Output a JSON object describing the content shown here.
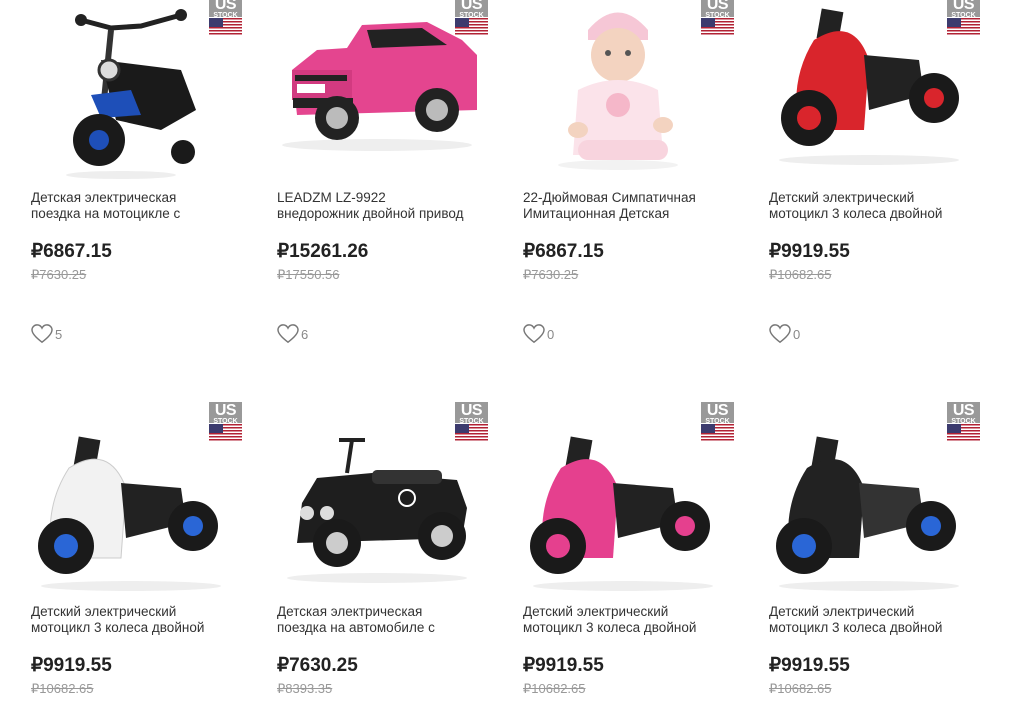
{
  "badge": {
    "us": "US",
    "stock": "STOCK"
  },
  "products": [
    {
      "title_l1": "Детская электрическая",
      "title_l2": "поездка на мотоцикле с",
      "price": "₽6867.15",
      "old_price": "₽7630.25",
      "likes": "5",
      "image": "kids-motorcycle-black-blue"
    },
    {
      "title_l1": "LEADZM LZ-9922",
      "title_l2": "внедорожник двойной привод",
      "price": "₽15261.26",
      "old_price": "₽17550.56",
      "likes": "6",
      "image": "pink-jeep"
    },
    {
      "title_l1": "22-Дюймовая Симпатичная",
      "title_l2": "Имитационная Детская",
      "price": "₽6867.15",
      "old_price": "₽7630.25",
      "likes": "0",
      "image": "reborn-doll"
    },
    {
      "title_l1": "Детский электрический",
      "title_l2": "мотоцикл 3 колеса двойной",
      "price": "₽9919.55",
      "old_price": "₽10682.65",
      "likes": "0",
      "image": "tricycle-red"
    },
    {
      "title_l1": "Детский электрический",
      "title_l2": "мотоцикл 3 колеса двойной",
      "price": "₽9919.55",
      "old_price": "₽10682.65",
      "image": "tricycle-white"
    },
    {
      "title_l1": "Детская электрическая",
      "title_l2": "поездка на автомобиле с",
      "price": "₽7630.25",
      "old_price": "₽8393.35",
      "image": "ride-on-car-black"
    },
    {
      "title_l1": "Детский электрический",
      "title_l2": "мотоцикл 3 колеса двойной",
      "price": "₽9919.55",
      "old_price": "₽10682.65",
      "image": "tricycle-pink"
    },
    {
      "title_l1": "Детский электрический",
      "title_l2": "мотоцикл 3 колеса двойной",
      "price": "₽9919.55",
      "old_price": "₽10682.65",
      "image": "tricycle-black"
    }
  ],
  "colors": {
    "price": "#222222",
    "old_price": "#999999",
    "badge_gray": "#999999",
    "flag_red": "#b22234",
    "flag_blue": "#3c3b6e"
  }
}
